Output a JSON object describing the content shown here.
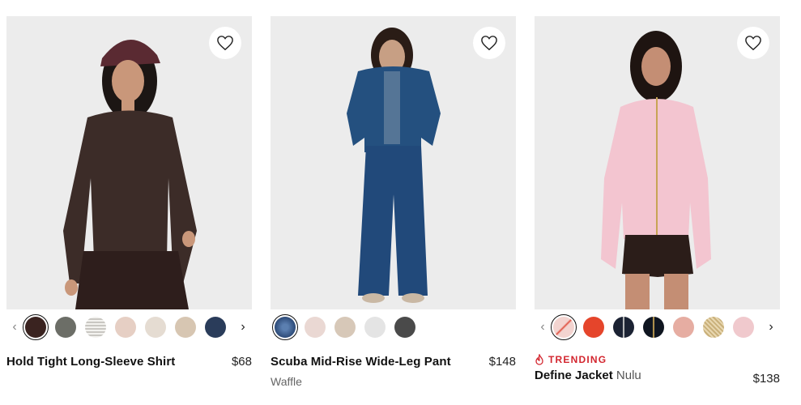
{
  "products": [
    {
      "name": "Hold Tight Long-Sleeve Shirt",
      "price": "$68",
      "subtitle": "",
      "swatches": [
        "#3a2320",
        "#6c6e67",
        "#d6d4d0",
        "#e6cfc4",
        "#e5dcd2",
        "#d7c6b2",
        "#2a3c5a"
      ],
      "selected_swatch": 0,
      "image_bg": "#ececec",
      "garment_color": "#3c2c28"
    },
    {
      "name": "Scuba Mid-Rise Wide-Leg Pant",
      "price": "$148",
      "subtitle": "Waffle",
      "swatches": [
        "#2c4a78",
        "#ead8d3",
        "#d7c8b8",
        "#e4e4e4",
        "#4a4a4a"
      ],
      "selected_swatch": 0,
      "image_bg": "#ececec",
      "garment_color": "#21497a"
    },
    {
      "badge": "TRENDING",
      "name": "Define Jacket",
      "name_suffix": "Nulu",
      "price": "$138",
      "swatches": [
        "#f3d4d0",
        "#e5452b",
        "#1b2233",
        "#0f1520",
        "#e6ada2",
        "#dcc8a0",
        "#f0c9cd"
      ],
      "selected_swatch": 0,
      "image_bg": "#ececec",
      "garment_color": "#f3c5d0"
    }
  ],
  "icons": {
    "heart": "heart-outline-icon",
    "prev": "chevron-left-icon",
    "next": "chevron-right-icon",
    "trending": "flame-icon"
  },
  "accent": "#d3262f"
}
